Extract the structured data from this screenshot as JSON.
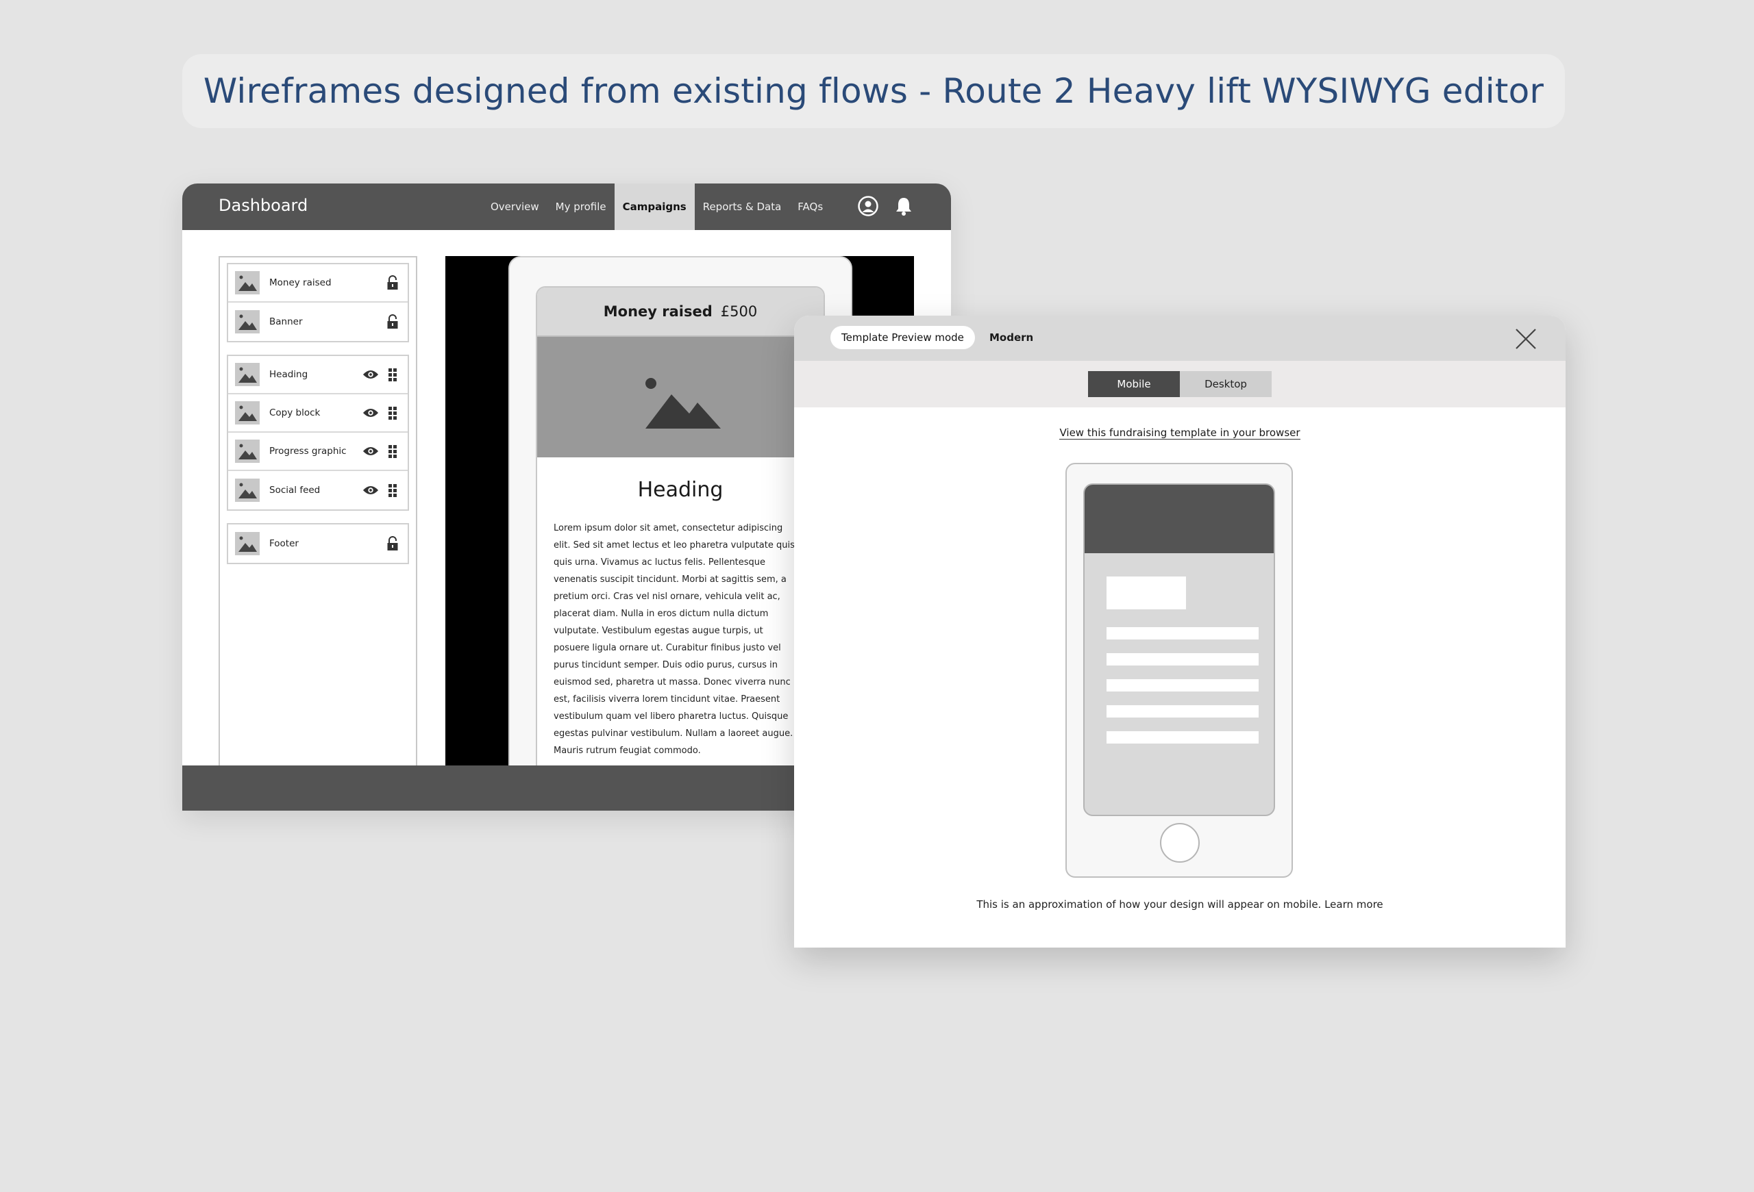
{
  "page": {
    "title": "Wireframes designed from existing flows - Route 2 Heavy lift WYSIWYG editor"
  },
  "dashboard": {
    "title": "Dashboard",
    "nav": [
      "Overview",
      "My profile",
      "Campaigns",
      "Reports & Data",
      "FAQs"
    ],
    "active_nav": "Campaigns",
    "icons": [
      "user-circle-icon",
      "bell-icon"
    ]
  },
  "sidebar": {
    "groups": [
      [
        {
          "label": "Money raised",
          "action": "lock-icon"
        },
        {
          "label": "Banner",
          "action": "lock-icon"
        }
      ],
      [
        {
          "label": "Heading",
          "actions": [
            "eye-icon",
            "drag-handle-icon"
          ]
        },
        {
          "label": "Copy block",
          "actions": [
            "eye-icon",
            "drag-handle-icon"
          ]
        },
        {
          "label": "Progress graphic",
          "actions": [
            "eye-icon",
            "drag-handle-icon"
          ]
        },
        {
          "label": "Social feed",
          "actions": [
            "eye-icon",
            "drag-handle-icon"
          ]
        }
      ],
      [
        {
          "label": "Footer",
          "action": "lock-icon"
        }
      ]
    ]
  },
  "preview": {
    "money_label": "Money raised",
    "money_value": "£500",
    "heading": "Heading",
    "copy_lines": [
      "Lorem ipsum dolor sit amet, consectetur adipiscing",
      "elit. Sed sit amet lectus et leo pharetra vulputate quis",
      "quis urna. Vivamus ac luctus felis. Pellentesque",
      "venenatis suscipit tincidunt. Morbi at sagittis sem, a",
      "pretium orci. Cras vel nisl ornare, vehicula velit ac,",
      "placerat diam. Nulla in eros dictum nulla dictum",
      "vulputate. Vestibulum egestas augue turpis, ut",
      "posuere ligula ornare ut. Curabitur finibus justo vel",
      "purus tincidunt semper. Duis odio purus, cursus in",
      "euismod sed, pharetra ut massa. Donec viverra nunc",
      "est, facilisis viverra lorem tincidunt vitae. Praesent",
      "vestibulum quam vel libero pharetra luctus. Quisque",
      "egestas pulvinar vestibulum. Nullam a laoreet augue.",
      "Mauris rutrum feugiat commodo."
    ]
  },
  "modal": {
    "mode_label": "Template Preview mode",
    "template_name": "Modern",
    "tabs": [
      "Mobile",
      "Desktop"
    ],
    "active_tab": "Mobile",
    "view_link": "View this fundraising template in your browser",
    "note": "This is an approximation of how your design will appear on mobile.",
    "learn_more": "Learn more"
  },
  "colors": {
    "background": "#e4e4e4",
    "title": "#2a4a78",
    "nav_bar": "#545454",
    "active_tab": "#4a4a4a"
  }
}
